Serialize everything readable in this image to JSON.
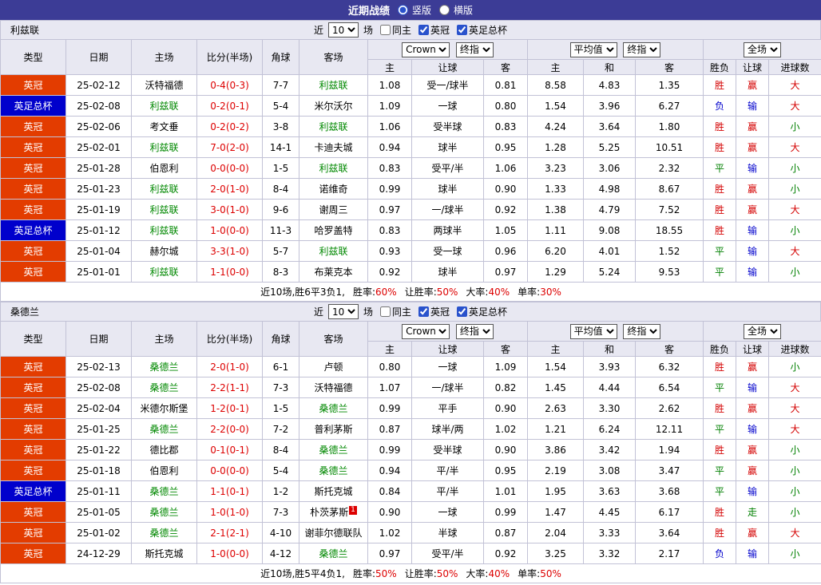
{
  "topbar": {
    "title": "近期战绩",
    "layout_options": [
      {
        "label": "竖版",
        "selected": true
      },
      {
        "label": "横版",
        "selected": false
      }
    ]
  },
  "filter": {
    "near": "近",
    "count": "10",
    "unit": "场",
    "checkboxes": [
      {
        "label": "同主",
        "checked": false
      },
      {
        "label": "英冠",
        "checked": true
      },
      {
        "label": "英足总杯",
        "checked": true
      }
    ]
  },
  "table_header": {
    "type": "类型",
    "date": "日期",
    "home": "主场",
    "score": "比分(半场)",
    "corner": "角球",
    "away": "客场",
    "asia_selects": [
      "Crown",
      "终指"
    ],
    "europe_selects": [
      "平均值",
      "终指"
    ],
    "scope_select": "全场",
    "asia_sub": [
      "主",
      "让球",
      "客"
    ],
    "europe_sub": [
      "主",
      "和",
      "客"
    ],
    "result_sub": [
      "胜负",
      "让球",
      "进球数"
    ]
  },
  "palette": {
    "red": "#d40000",
    "green": "#008000",
    "blue": "#0000cc",
    "team": "#008800",
    "score": "#dd0000",
    "topbar_bg": "#3c3c96",
    "header_bg": "#e8e8f2",
    "border": "#c2c2d6"
  },
  "value_colors": {
    "胜": "red",
    "平": "green",
    "负": "blue",
    "赢": "red",
    "走": "green",
    "输": "blue",
    "大": "red",
    "小": "green"
  },
  "type_colors": {
    "英冠": "#e33c00",
    "英足总杯": "#0000cc"
  },
  "sections": [
    {
      "team": "利兹联",
      "rows": [
        {
          "type": "英冠",
          "date": "25-02-12",
          "home": "沃特福德",
          "home_is_focus": false,
          "score": "0-4(0-3)",
          "corner": "7-7",
          "away": "利兹联",
          "away_is_focus": true,
          "asia": [
            "1.08",
            "受一/球半",
            "0.81"
          ],
          "europe": [
            "8.58",
            "4.83",
            "1.35"
          ],
          "result": "胜",
          "handicap_result": "赢",
          "goals": "大"
        },
        {
          "type": "英足总杯",
          "date": "25-02-08",
          "home": "利兹联",
          "home_is_focus": true,
          "score": "0-2(0-1)",
          "corner": "5-4",
          "away": "米尔沃尔",
          "away_is_focus": false,
          "asia": [
            "1.09",
            "一球",
            "0.80"
          ],
          "europe": [
            "1.54",
            "3.96",
            "6.27"
          ],
          "result": "负",
          "handicap_result": "输",
          "goals": "大"
        },
        {
          "type": "英冠",
          "date": "25-02-06",
          "home": "考文垂",
          "home_is_focus": false,
          "score": "0-2(0-2)",
          "corner": "3-8",
          "away": "利兹联",
          "away_is_focus": true,
          "asia": [
            "1.06",
            "受半球",
            "0.83"
          ],
          "europe": [
            "4.24",
            "3.64",
            "1.80"
          ],
          "result": "胜",
          "handicap_result": "赢",
          "goals": "小"
        },
        {
          "type": "英冠",
          "date": "25-02-01",
          "home": "利兹联",
          "home_is_focus": true,
          "score": "7-0(2-0)",
          "corner": "14-1",
          "away": "卡迪夫城",
          "away_is_focus": false,
          "asia": [
            "0.94",
            "球半",
            "0.95"
          ],
          "europe": [
            "1.28",
            "5.25",
            "10.51"
          ],
          "result": "胜",
          "handicap_result": "赢",
          "goals": "大"
        },
        {
          "type": "英冠",
          "date": "25-01-28",
          "home": "伯恩利",
          "home_is_focus": false,
          "score": "0-0(0-0)",
          "corner": "1-5",
          "away": "利兹联",
          "away_is_focus": true,
          "asia": [
            "0.83",
            "受平/半",
            "1.06"
          ],
          "europe": [
            "3.23",
            "3.06",
            "2.32"
          ],
          "result": "平",
          "handicap_result": "输",
          "goals": "小"
        },
        {
          "type": "英冠",
          "date": "25-01-23",
          "home": "利兹联",
          "home_is_focus": true,
          "score": "2-0(1-0)",
          "corner": "8-4",
          "away": "诺维奇",
          "away_is_focus": false,
          "asia": [
            "0.99",
            "球半",
            "0.90"
          ],
          "europe": [
            "1.33",
            "4.98",
            "8.67"
          ],
          "result": "胜",
          "handicap_result": "赢",
          "goals": "小"
        },
        {
          "type": "英冠",
          "date": "25-01-19",
          "home": "利兹联",
          "home_is_focus": true,
          "score": "3-0(1-0)",
          "corner": "9-6",
          "away": "谢周三",
          "away_is_focus": false,
          "asia": [
            "0.97",
            "一/球半",
            "0.92"
          ],
          "europe": [
            "1.38",
            "4.79",
            "7.52"
          ],
          "result": "胜",
          "handicap_result": "赢",
          "goals": "大"
        },
        {
          "type": "英足总杯",
          "date": "25-01-12",
          "home": "利兹联",
          "home_is_focus": true,
          "score": "1-0(0-0)",
          "corner": "11-3",
          "away": "哈罗盖特",
          "away_is_focus": false,
          "asia": [
            "0.83",
            "两球半",
            "1.05"
          ],
          "europe": [
            "1.11",
            "9.08",
            "18.55"
          ],
          "result": "胜",
          "handicap_result": "输",
          "goals": "小"
        },
        {
          "type": "英冠",
          "date": "25-01-04",
          "home": "赫尔城",
          "home_is_focus": false,
          "score": "3-3(1-0)",
          "corner": "5-7",
          "away": "利兹联",
          "away_is_focus": true,
          "asia": [
            "0.93",
            "受一球",
            "0.96"
          ],
          "europe": [
            "6.20",
            "4.01",
            "1.52"
          ],
          "result": "平",
          "handicap_result": "输",
          "goals": "大"
        },
        {
          "type": "英冠",
          "date": "25-01-01",
          "home": "利兹联",
          "home_is_focus": true,
          "score": "1-1(0-0)",
          "corner": "8-3",
          "away": "布莱克本",
          "away_is_focus": false,
          "asia": [
            "0.92",
            "球半",
            "0.97"
          ],
          "europe": [
            "1.29",
            "5.24",
            "9.53"
          ],
          "result": "平",
          "handicap_result": "输",
          "goals": "小"
        }
      ],
      "summary": {
        "prefix": "近10场,胜6平3负1,",
        "stats": [
          {
            "label": "胜率:",
            "value": "60%"
          },
          {
            "label": "让胜率:",
            "value": "50%"
          },
          {
            "label": "大率:",
            "value": "40%"
          },
          {
            "label": "单率:",
            "value": "30%"
          }
        ]
      }
    },
    {
      "team": "桑德兰",
      "rows": [
        {
          "type": "英冠",
          "date": "25-02-13",
          "home": "桑德兰",
          "home_is_focus": true,
          "score": "2-0(1-0)",
          "corner": "6-1",
          "away": "卢顿",
          "away_is_focus": false,
          "asia": [
            "0.80",
            "一球",
            "1.09"
          ],
          "europe": [
            "1.54",
            "3.93",
            "6.32"
          ],
          "result": "胜",
          "handicap_result": "赢",
          "goals": "小"
        },
        {
          "type": "英冠",
          "date": "25-02-08",
          "home": "桑德兰",
          "home_is_focus": true,
          "score": "2-2(1-1)",
          "corner": "7-3",
          "away": "沃特福德",
          "away_is_focus": false,
          "asia": [
            "1.07",
            "一/球半",
            "0.82"
          ],
          "europe": [
            "1.45",
            "4.44",
            "6.54"
          ],
          "result": "平",
          "handicap_result": "输",
          "goals": "大"
        },
        {
          "type": "英冠",
          "date": "25-02-04",
          "home": "米德尔斯堡",
          "home_is_focus": false,
          "score": "1-2(0-1)",
          "corner": "1-5",
          "away": "桑德兰",
          "away_is_focus": true,
          "asia": [
            "0.99",
            "平手",
            "0.90"
          ],
          "europe": [
            "2.63",
            "3.30",
            "2.62"
          ],
          "result": "胜",
          "handicap_result": "赢",
          "goals": "大"
        },
        {
          "type": "英冠",
          "date": "25-01-25",
          "home": "桑德兰",
          "home_is_focus": true,
          "score": "2-2(0-0)",
          "corner": "7-2",
          "away": "普利茅斯",
          "away_is_focus": false,
          "asia": [
            "0.87",
            "球半/两",
            "1.02"
          ],
          "europe": [
            "1.21",
            "6.24",
            "12.11"
          ],
          "result": "平",
          "handicap_result": "输",
          "goals": "大"
        },
        {
          "type": "英冠",
          "date": "25-01-22",
          "home": "德比郡",
          "home_is_focus": false,
          "score": "0-1(0-1)",
          "corner": "8-4",
          "away": "桑德兰",
          "away_is_focus": true,
          "asia": [
            "0.99",
            "受半球",
            "0.90"
          ],
          "europe": [
            "3.86",
            "3.42",
            "1.94"
          ],
          "result": "胜",
          "handicap_result": "赢",
          "goals": "小"
        },
        {
          "type": "英冠",
          "date": "25-01-18",
          "home": "伯恩利",
          "home_is_focus": false,
          "score": "0-0(0-0)",
          "corner": "5-4",
          "away": "桑德兰",
          "away_is_focus": true,
          "asia": [
            "0.94",
            "平/半",
            "0.95"
          ],
          "europe": [
            "2.19",
            "3.08",
            "3.47"
          ],
          "result": "平",
          "handicap_result": "赢",
          "goals": "小"
        },
        {
          "type": "英足总杯",
          "date": "25-01-11",
          "home": "桑德兰",
          "home_is_focus": true,
          "score": "1-1(0-1)",
          "corner": "1-2",
          "away": "斯托克城",
          "away_is_focus": false,
          "asia": [
            "0.84",
            "平/半",
            "1.01"
          ],
          "europe": [
            "1.95",
            "3.63",
            "3.68"
          ],
          "result": "平",
          "handicap_result": "输",
          "goals": "小"
        },
        {
          "type": "英冠",
          "date": "25-01-05",
          "home": "桑德兰",
          "home_is_focus": true,
          "score": "1-0(1-0)",
          "corner": "7-3",
          "away": "朴茨茅斯",
          "away_badge": "1",
          "away_is_focus": false,
          "asia": [
            "0.90",
            "一球",
            "0.99"
          ],
          "europe": [
            "1.47",
            "4.45",
            "6.17"
          ],
          "result": "胜",
          "handicap_result": "走",
          "goals": "小"
        },
        {
          "type": "英冠",
          "date": "25-01-02",
          "home": "桑德兰",
          "home_is_focus": true,
          "score": "2-1(2-1)",
          "corner": "4-10",
          "away": "谢菲尔德联队",
          "away_is_focus": false,
          "asia": [
            "1.02",
            "半球",
            "0.87"
          ],
          "europe": [
            "2.04",
            "3.33",
            "3.64"
          ],
          "result": "胜",
          "handicap_result": "赢",
          "goals": "大"
        },
        {
          "type": "英冠",
          "date": "24-12-29",
          "home": "斯托克城",
          "home_is_focus": false,
          "score": "1-0(0-0)",
          "corner": "4-12",
          "away": "桑德兰",
          "away_is_focus": true,
          "asia": [
            "0.97",
            "受平/半",
            "0.92"
          ],
          "europe": [
            "3.25",
            "3.32",
            "2.17"
          ],
          "result": "负",
          "handicap_result": "输",
          "goals": "小"
        }
      ],
      "summary": {
        "prefix": "近10场,胜5平4负1,",
        "stats": [
          {
            "label": "胜率:",
            "value": "50%"
          },
          {
            "label": "让胜率:",
            "value": "50%"
          },
          {
            "label": "大率:",
            "value": "40%"
          },
          {
            "label": "单率:",
            "value": "50%"
          }
        ]
      }
    }
  ]
}
